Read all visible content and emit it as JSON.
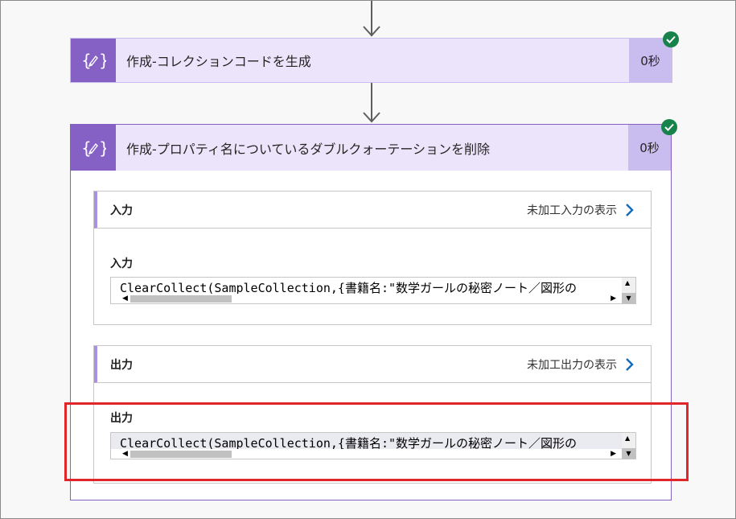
{
  "colors": {
    "accent": "#8661c5",
    "header_bg": "#ebe4fb",
    "time_bg": "#c9bdf0",
    "success": "#17834a",
    "link_chevron": "#0f6cbd",
    "highlight_border": "#e1262a"
  },
  "actions": [
    {
      "title": "作成-コレクションコードを生成",
      "duration": "0秒",
      "icon": "curly-braces-pencil-icon",
      "status": "succeeded"
    },
    {
      "title": "作成-プロパティ名についているダブルクォーテーションを削除",
      "duration": "0秒",
      "icon": "curly-braces-pencil-icon",
      "status": "succeeded",
      "input_section": {
        "heading": "入力",
        "raw_link": "未加工入力の表示",
        "field_label": "入力",
        "value": "ClearCollect(SampleCollection,{書籍名:\"数学ガールの秘密ノート／図形の"
      },
      "output_section": {
        "heading": "出力",
        "raw_link": "未加工出力の表示",
        "field_label": "出力",
        "value": "ClearCollect(SampleCollection,{書籍名:\"数学ガールの秘密ノート／図形の"
      }
    }
  ]
}
